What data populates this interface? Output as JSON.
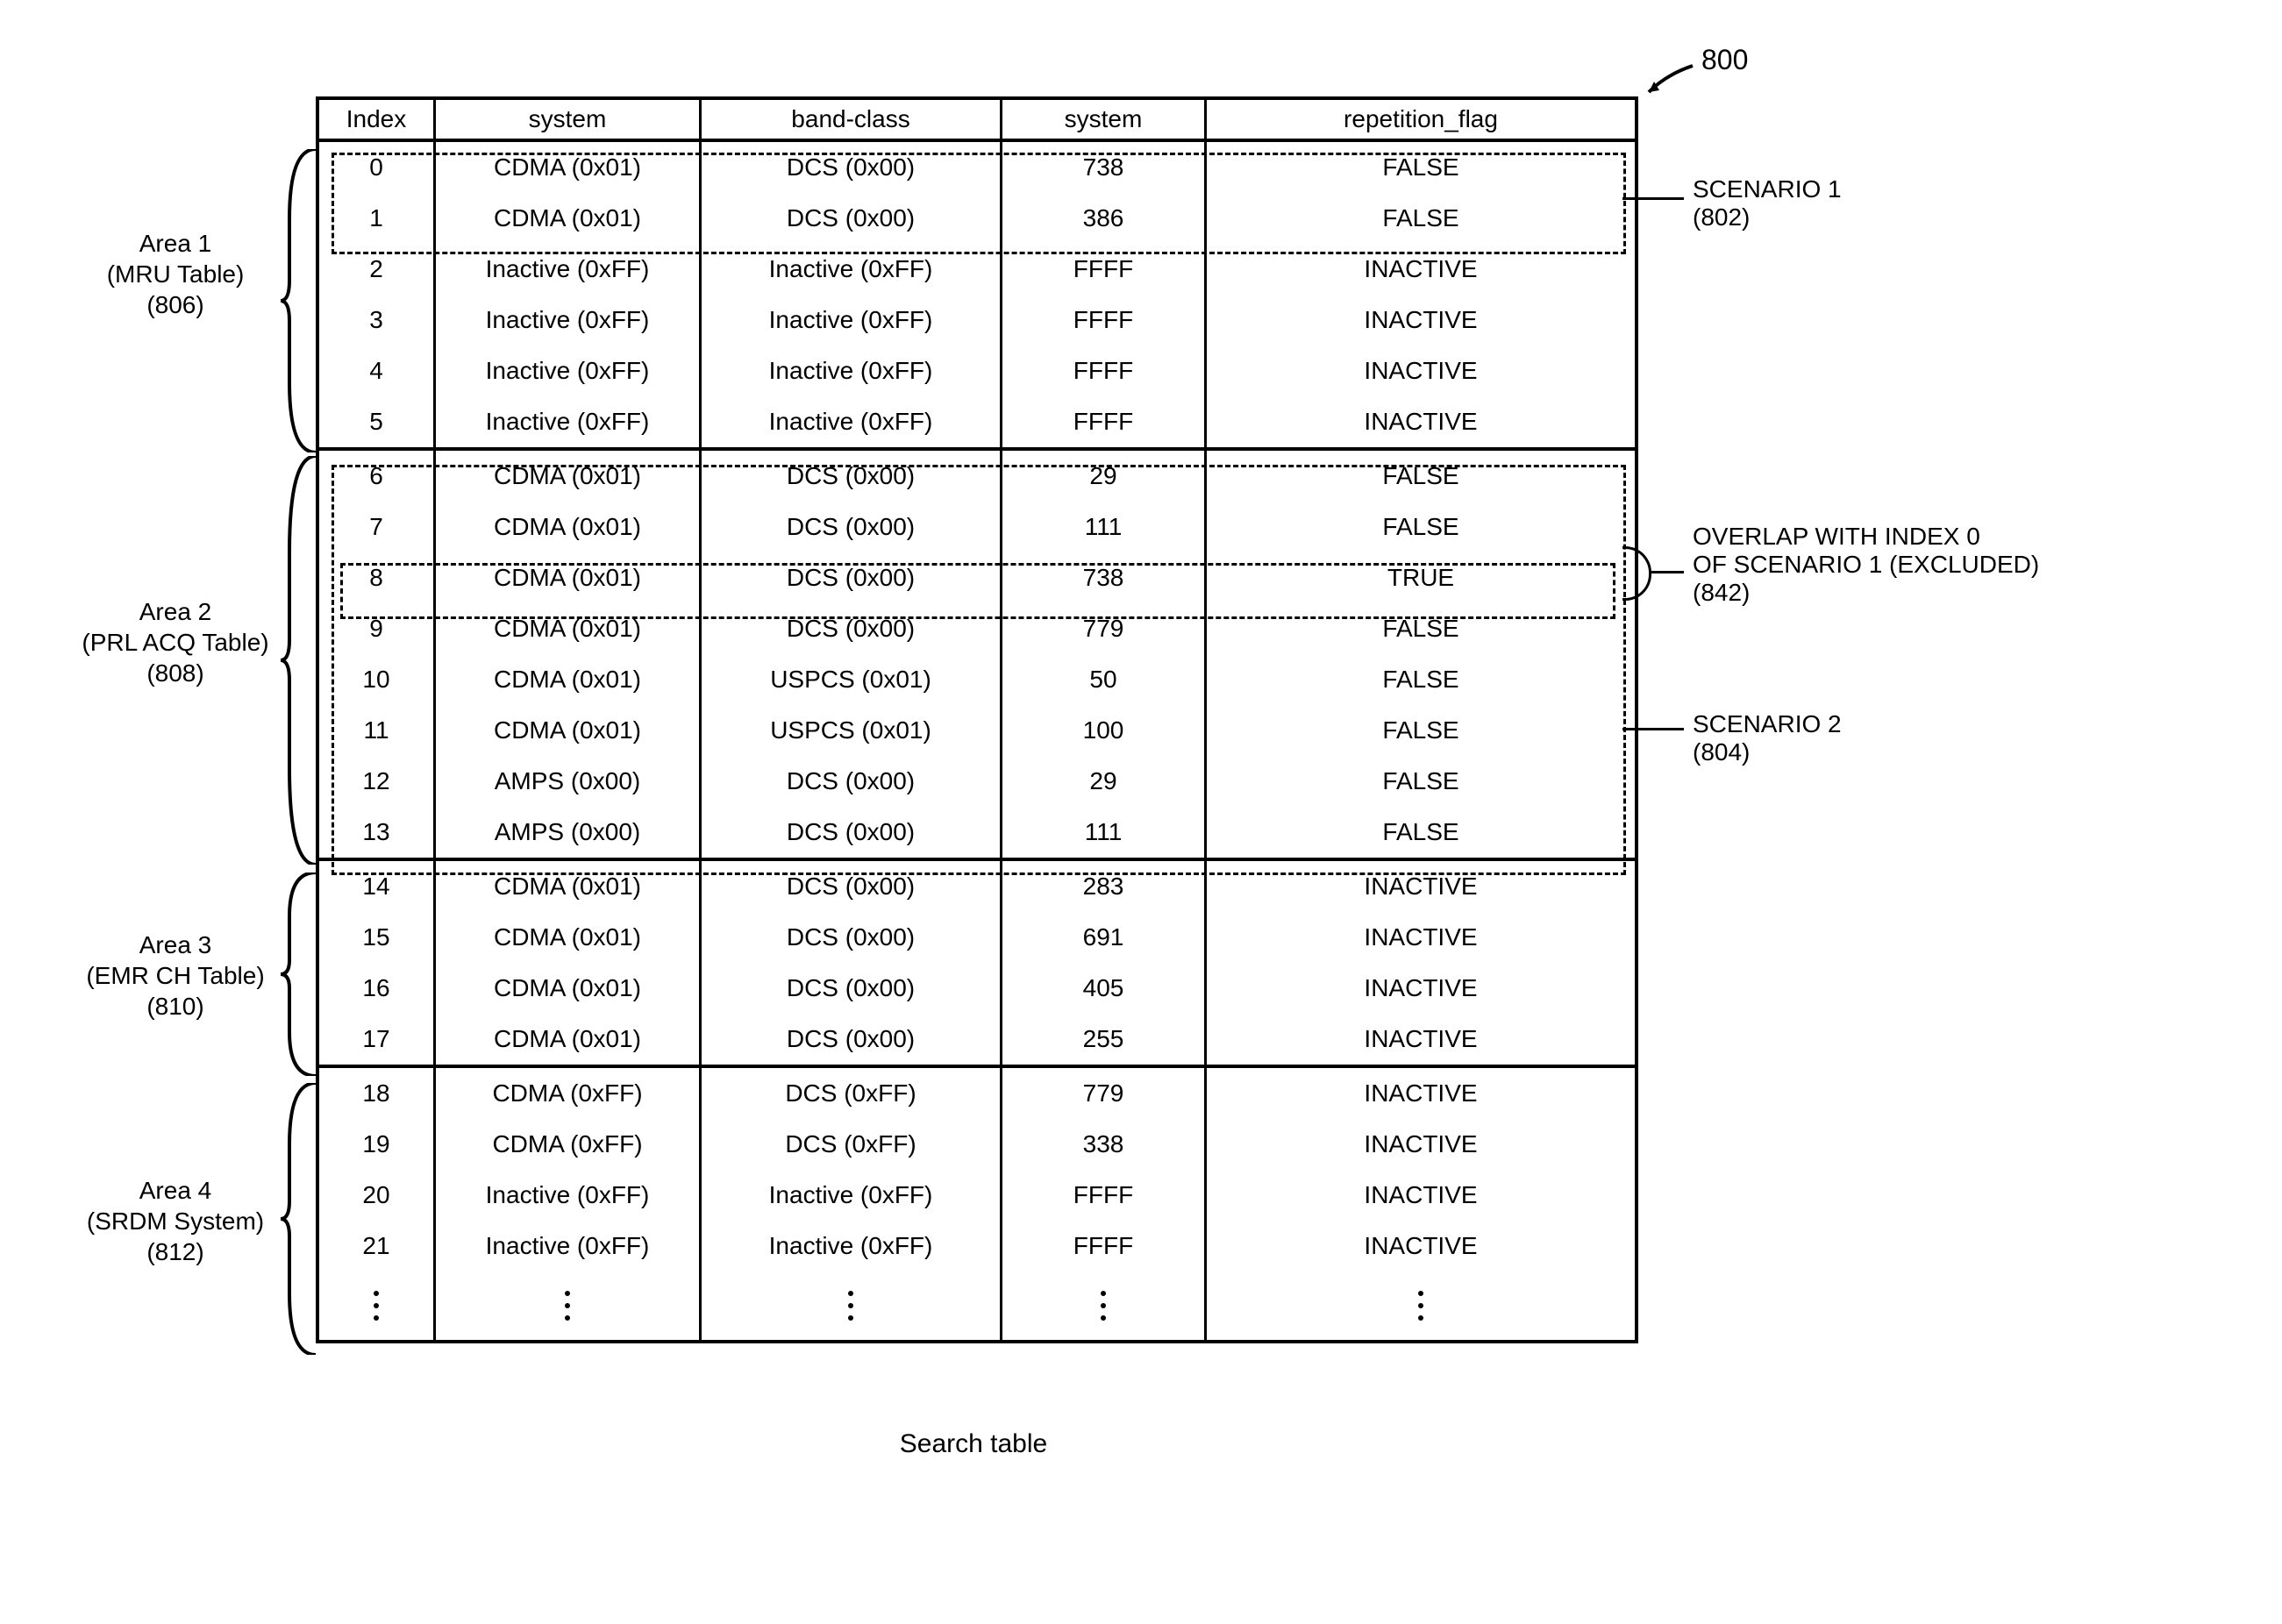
{
  "figure_number": "800",
  "caption": "Search table",
  "headers": {
    "c0": "Index",
    "c1": "system",
    "c2": "band-class",
    "c3": "system",
    "c4": "repetition_flag"
  },
  "areas": [
    {
      "name": "Area 1",
      "sub": "(MRU Table)",
      "code": "(806)",
      "rows": [
        {
          "i": "0",
          "s": "CDMA (0x01)",
          "b": "DCS (0x00)",
          "v": "738",
          "r": "FALSE"
        },
        {
          "i": "1",
          "s": "CDMA (0x01)",
          "b": "DCS (0x00)",
          "v": "386",
          "r": "FALSE"
        },
        {
          "i": "2",
          "s": "Inactive (0xFF)",
          "b": "Inactive (0xFF)",
          "v": "FFFF",
          "r": "INACTIVE"
        },
        {
          "i": "3",
          "s": "Inactive (0xFF)",
          "b": "Inactive (0xFF)",
          "v": "FFFF",
          "r": "INACTIVE"
        },
        {
          "i": "4",
          "s": "Inactive (0xFF)",
          "b": "Inactive (0xFF)",
          "v": "FFFF",
          "r": "INACTIVE"
        },
        {
          "i": "5",
          "s": "Inactive (0xFF)",
          "b": "Inactive (0xFF)",
          "v": "FFFF",
          "r": "INACTIVE"
        }
      ]
    },
    {
      "name": "Area 2",
      "sub": "(PRL ACQ Table)",
      "code": "(808)",
      "rows": [
        {
          "i": "6",
          "s": "CDMA (0x01)",
          "b": "DCS (0x00)",
          "v": "29",
          "r": "FALSE"
        },
        {
          "i": "7",
          "s": "CDMA (0x01)",
          "b": "DCS (0x00)",
          "v": "111",
          "r": "FALSE"
        },
        {
          "i": "8",
          "s": "CDMA (0x01)",
          "b": "DCS (0x00)",
          "v": "738",
          "r": "TRUE"
        },
        {
          "i": "9",
          "s": "CDMA (0x01)",
          "b": "DCS (0x00)",
          "v": "779",
          "r": "FALSE"
        },
        {
          "i": "10",
          "s": "CDMA (0x01)",
          "b": "USPCS (0x01)",
          "v": "50",
          "r": "FALSE"
        },
        {
          "i": "11",
          "s": "CDMA (0x01)",
          "b": "USPCS (0x01)",
          "v": "100",
          "r": "FALSE"
        },
        {
          "i": "12",
          "s": "AMPS (0x00)",
          "b": "DCS (0x00)",
          "v": "29",
          "r": "FALSE"
        },
        {
          "i": "13",
          "s": "AMPS (0x00)",
          "b": "DCS (0x00)",
          "v": "111",
          "r": "FALSE"
        }
      ]
    },
    {
      "name": "Area 3",
      "sub": "(EMR CH Table)",
      "code": "(810)",
      "rows": [
        {
          "i": "14",
          "s": "CDMA (0x01)",
          "b": "DCS (0x00)",
          "v": "283",
          "r": "INACTIVE"
        },
        {
          "i": "15",
          "s": "CDMA (0x01)",
          "b": "DCS (0x00)",
          "v": "691",
          "r": "INACTIVE"
        },
        {
          "i": "16",
          "s": "CDMA (0x01)",
          "b": "DCS (0x00)",
          "v": "405",
          "r": "INACTIVE"
        },
        {
          "i": "17",
          "s": "CDMA (0x01)",
          "b": "DCS (0x00)",
          "v": "255",
          "r": "INACTIVE"
        }
      ]
    },
    {
      "name": "Area 4",
      "sub": "(SRDM System)",
      "code": "(812)",
      "rows": [
        {
          "i": "18",
          "s": "CDMA (0xFF)",
          "b": "DCS (0xFF)",
          "v": "779",
          "r": "INACTIVE"
        },
        {
          "i": "19",
          "s": "CDMA (0xFF)",
          "b": "DCS (0xFF)",
          "v": "338",
          "r": "INACTIVE"
        },
        {
          "i": "20",
          "s": "Inactive (0xFF)",
          "b": "Inactive (0xFF)",
          "v": "FFFF",
          "r": "INACTIVE"
        },
        {
          "i": "21",
          "s": "Inactive (0xFF)",
          "b": "Inactive (0xFF)",
          "v": "FFFF",
          "r": "INACTIVE"
        }
      ]
    }
  ],
  "callouts": {
    "scenario1": {
      "l1": "SCENARIO 1",
      "l2": "(802)"
    },
    "overlap": {
      "l1": "OVERLAP WITH INDEX 0",
      "l2": "OF SCENARIO 1 (EXCLUDED)",
      "l3": "(842)"
    },
    "scenario2": {
      "l1": "SCENARIO 2",
      "l2": "(804)"
    }
  }
}
